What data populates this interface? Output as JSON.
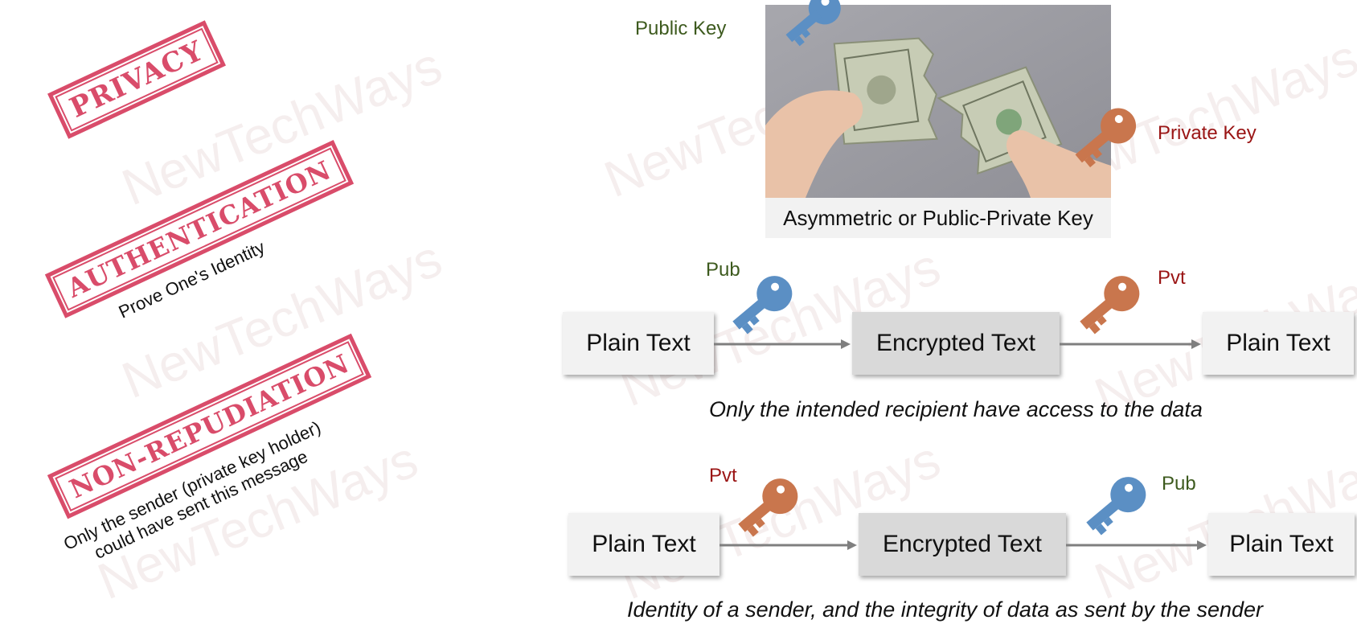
{
  "stamps": {
    "privacy": "PRIVACY",
    "authentication": "AUTHENTICATION",
    "authentication_caption": "Prove One's Identity",
    "non_repudiation": "NON-REPUDIATION",
    "non_repudiation_caption_line1": "Only the sender (private key holder)",
    "non_repudiation_caption_line2": "could have sent this message"
  },
  "watermark": "NewTechWays",
  "top": {
    "public_key_label": "Public Key",
    "private_key_label": "Private Key",
    "image_caption": "Asymmetric or Public-Private Key"
  },
  "flow1": {
    "key1_label": "Pub",
    "key2_label": "Pvt",
    "box1": "Plain Text",
    "box2": "Encrypted Text",
    "box3": "Plain Text",
    "caption": "Only the intended recipient have access to the data"
  },
  "flow2": {
    "key1_label": "Pvt",
    "key2_label": "Pub",
    "box1": "Plain Text",
    "box2": "Encrypted Text",
    "box3": "Plain Text",
    "caption": "Identity of a sender, and the integrity of data as sent by the sender"
  },
  "colors": {
    "stamp": "#d94c6a",
    "public_key": "#5b8fc4",
    "private_key": "#c9764d",
    "green_label": "#3d5a1e",
    "red_label": "#9a1414"
  },
  "icons": [
    "blue-key-icon",
    "orange-key-icon",
    "arrow-icon"
  ]
}
